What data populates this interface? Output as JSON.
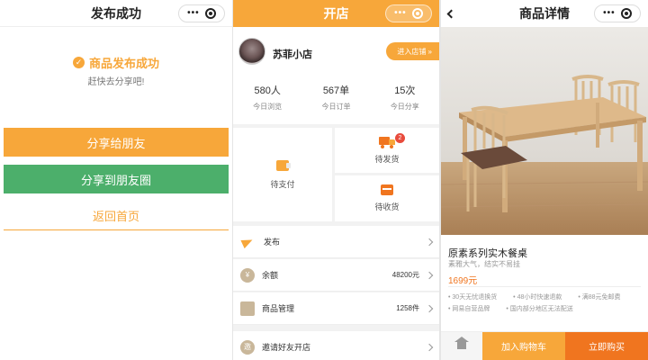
{
  "colors": {
    "accent": "#f7a73a",
    "accent_dark": "#f0751f",
    "green": "#4caf6b",
    "badge_red": "#e84b3c"
  },
  "publish_success": {
    "title": "发布成功",
    "success_text": "商品发布成功",
    "hint": "赶快去分享吧!",
    "share_friend": "分享给朋友",
    "share_moments": "分享到朋友圈",
    "back_home": "返回首页"
  },
  "shop": {
    "title": "开店",
    "shop_name": "苏菲小店",
    "enter_shop": "进入店铺 »",
    "stats": [
      {
        "value": "580人",
        "label": "今日浏览"
      },
      {
        "value": "567单",
        "label": "今日订单"
      },
      {
        "value": "15次",
        "label": "今日分享"
      }
    ],
    "grid": {
      "pending_payment": "待支付",
      "pending_shipment": "待发货",
      "pending_shipment_badge": "2",
      "pending_receipt": "待收货"
    },
    "menu": [
      {
        "label": "发布",
        "value": ""
      },
      {
        "label": "余额",
        "value": "48200元",
        "icon": "¥"
      },
      {
        "label": "商品管理",
        "value": "1258件"
      },
      {
        "label": "邀请好友开店",
        "value": ""
      }
    ]
  },
  "product": {
    "title": "商品详情",
    "name": "原素系列实木餐桌",
    "subtitle": "素雅大气，结实不易挂",
    "price": "1699元",
    "features": [
      "30天无忧退换货",
      "48小时快速退款",
      "满88元免邮费",
      "网易自营品牌",
      "国内部分地区无法配送"
    ],
    "add_to_cart": "加入购物车",
    "buy_now": "立即购买"
  }
}
